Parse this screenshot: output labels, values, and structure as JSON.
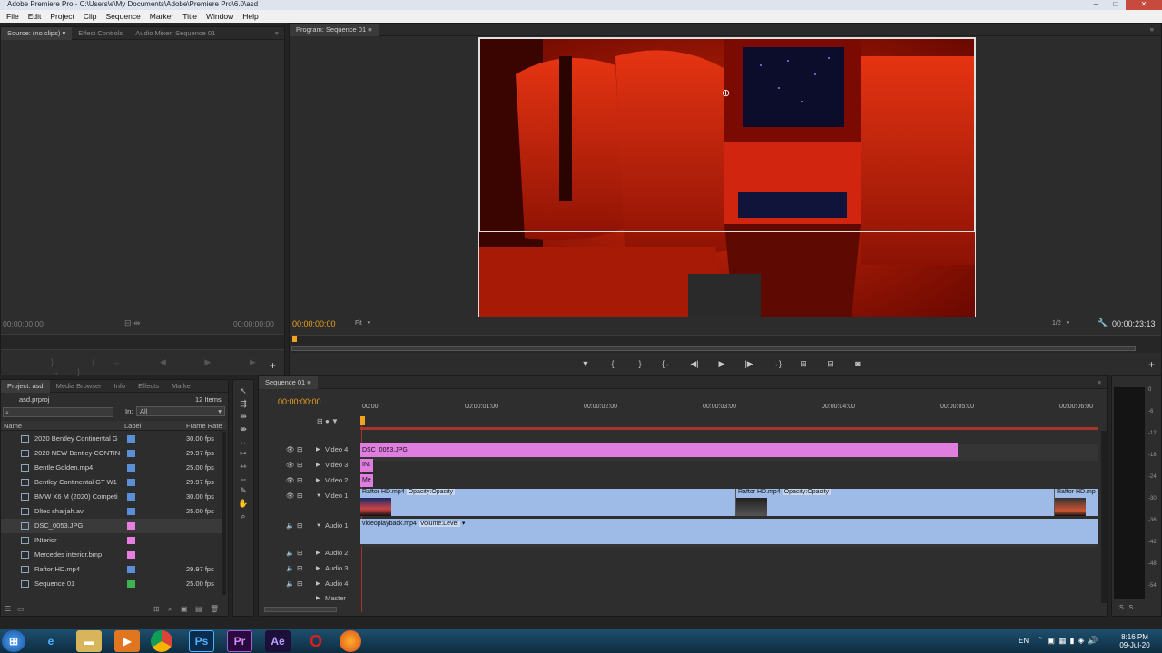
{
  "window": {
    "title": "Adobe Premiere Pro - C:\\Users\\e\\My Documents\\Adobe\\Premiere Pro\\6.0\\asd"
  },
  "menu": [
    "File",
    "Edit",
    "Project",
    "Clip",
    "Sequence",
    "Marker",
    "Title",
    "Window",
    "Help"
  ],
  "source_panel": {
    "tabs": [
      "Source: (no clips)",
      "Effect Controls",
      "Audio Mixer: Sequence 01"
    ],
    "timecode_left": "00;00;00;00",
    "timecode_right": "00;00;00;00"
  },
  "program_panel": {
    "tab": "Program: Sequence 01",
    "timecode": "00:00:00:00",
    "fit": "Fit",
    "resolution": "1/2",
    "duration": "00:00:23:13"
  },
  "project_panel": {
    "tabs": [
      "Project: asd",
      "Media Browser",
      "Info",
      "Effects",
      "Marke"
    ],
    "project_file": "asd.prproj",
    "item_count": "12 Items",
    "in_label": "In:",
    "in_value": "All",
    "columns": {
      "name": "Name",
      "label": "Label",
      "frame_rate": "Frame Rate"
    },
    "items": [
      {
        "name": "2020 Bentley Continental G",
        "color": "#5a8fd8",
        "fps": "30.00 fps"
      },
      {
        "name": "2020 NEW Bentley CONTIN",
        "color": "#5a8fd8",
        "fps": "29.97 fps"
      },
      {
        "name": "Bentle Golden.mp4",
        "color": "#5a8fd8",
        "fps": "25.00 fps"
      },
      {
        "name": "Bentley Continental GT W1",
        "color": "#5a8fd8",
        "fps": "29.97 fps"
      },
      {
        "name": "BMW X6 M (2020) Competi",
        "color": "#5a8fd8",
        "fps": "30.00 fps"
      },
      {
        "name": "Dltec sharjah.avi",
        "color": "#5a8fd8",
        "fps": "25.00 fps"
      },
      {
        "name": "DSC_0053.JPG",
        "color": "#e67fe0",
        "fps": ""
      },
      {
        "name": "INterior",
        "color": "#e67fe0",
        "fps": ""
      },
      {
        "name": "Mercedes interior.bmp",
        "color": "#e67fe0",
        "fps": ""
      },
      {
        "name": "Raftor HD.mp4",
        "color": "#5a8fd8",
        "fps": "29.97 fps"
      },
      {
        "name": "Sequence 01",
        "color": "#3fb34f",
        "fps": "25.00 fps"
      }
    ]
  },
  "timeline": {
    "tab": "Sequence 01",
    "timecode": "00:00:00:00",
    "ruler": [
      "00:00",
      "00:00:01:00",
      "00:00:02:00",
      "00:00:03:00",
      "00:00:04:00",
      "00:00:05:00",
      "00:00:06:00"
    ],
    "tracks": [
      {
        "name": "Video 4"
      },
      {
        "name": "Video 3"
      },
      {
        "name": "Video 2"
      },
      {
        "name": "Video 1"
      },
      {
        "name": "Audio 1"
      },
      {
        "name": "Audio 2"
      },
      {
        "name": "Audio 3"
      },
      {
        "name": "Audio 4"
      },
      {
        "name": "Master"
      }
    ],
    "clips": {
      "v4": "DSC_0053.JPG",
      "v3": "INt",
      "v2": "Me",
      "v1a": "Raftor HD.mp4",
      "v1a_fx": "Opacity:Opacity",
      "v1b": "Raftor HD.mp4",
      "v1b_fx": "Opacity:Opacity",
      "v1c": "Raftor HD.mp",
      "a1": "videoplayback.mp4",
      "a1_fx": "Volume:Level"
    }
  },
  "audio_meter": {
    "ticks": [
      "0",
      "-6",
      "-12",
      "-18",
      "-24",
      "-30",
      "-36",
      "-42",
      "-48",
      "-54"
    ]
  },
  "taskbar": {
    "language": "EN",
    "time": "8:16 PM",
    "date": "09-Jul-20",
    "apps": [
      "start",
      "ie",
      "explorer",
      "media-player",
      "chrome",
      "Ps",
      "Pr",
      "Ae",
      "opera",
      "firefox"
    ]
  }
}
